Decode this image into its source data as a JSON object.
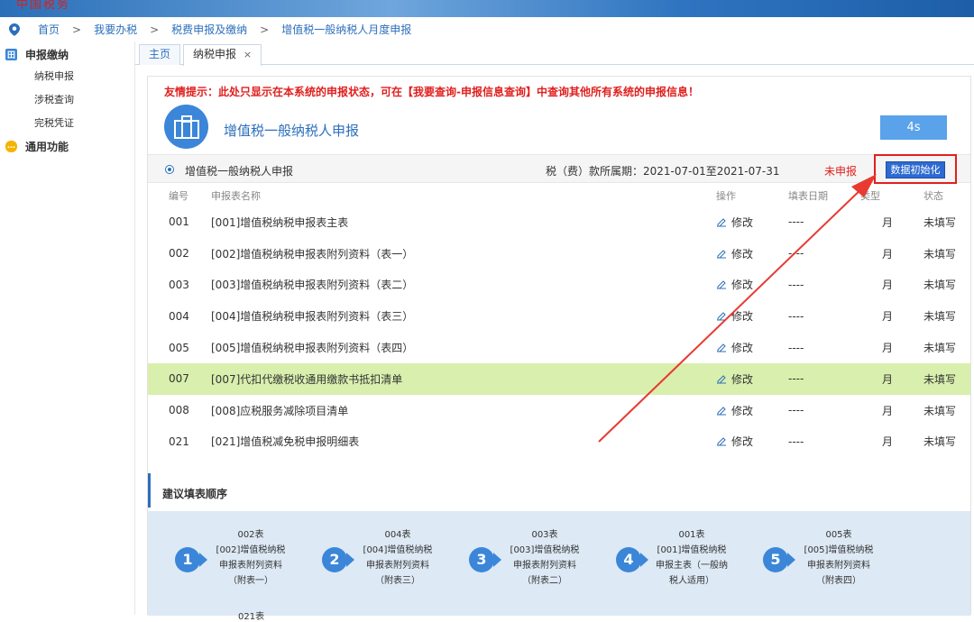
{
  "banner": {
    "logo_text": "中国税务"
  },
  "breadcrumb": {
    "items": [
      "首页",
      "我要办税",
      "税费申报及缴纳",
      "增值税一般纳税人月度申报"
    ],
    "separator": ">"
  },
  "sidebar": {
    "groups": [
      {
        "label": "申报缴纳",
        "icon": "grid-icon",
        "items": [
          "纳税申报",
          "涉税查询",
          "完税凭证"
        ]
      },
      {
        "label": "通用功能",
        "icon": "chat-icon",
        "items": []
      }
    ]
  },
  "tabs": [
    {
      "label": "主页"
    },
    {
      "label": "纳税申报",
      "close": "×"
    }
  ],
  "notice": "友情提示：此处只显示在本系统的申报状态，可在【我要查询-申报信息查询】中查询其他所有系统的申报信息！",
  "header": {
    "title": "增值税一般纳税人申报",
    "timer": "4s"
  },
  "declaration": {
    "name": "增值税一般纳税人申报",
    "period": "税（费）款所属期：2021-07-01至2021-07-31",
    "status": "未申报",
    "init_button": "数据初始化"
  },
  "table": {
    "columns": [
      "编号",
      "申报表名称",
      "操作",
      "填表日期",
      "类型",
      "状态"
    ],
    "rows": [
      {
        "no": "001",
        "name": "[001]增值税纳税申报表主表",
        "op": "修改",
        "date": "----",
        "type": "月",
        "status": "未填写"
      },
      {
        "no": "002",
        "name": "[002]增值税纳税申报表附列资料（表一）",
        "op": "修改",
        "date": "----",
        "type": "月",
        "status": "未填写"
      },
      {
        "no": "003",
        "name": "[003]增值税纳税申报表附列资料（表二）",
        "op": "修改",
        "date": "----",
        "type": "月",
        "status": "未填写"
      },
      {
        "no": "004",
        "name": "[004]增值税纳税申报表附列资料（表三）",
        "op": "修改",
        "date": "----",
        "type": "月",
        "status": "未填写"
      },
      {
        "no": "005",
        "name": "[005]增值税纳税申报表附列资料（表四）",
        "op": "修改",
        "date": "----",
        "type": "月",
        "status": "未填写"
      },
      {
        "no": "007",
        "name": "[007]代扣代缴税收通用缴款书抵扣清单",
        "op": "修改",
        "date": "----",
        "type": "月",
        "status": "未填写"
      },
      {
        "no": "008",
        "name": "[008]应税服务减除项目清单",
        "op": "修改",
        "date": "----",
        "type": "月",
        "status": "未填写"
      },
      {
        "no": "021",
        "name": "[021]增值税减免税申报明细表",
        "op": "修改",
        "date": "----",
        "type": "月",
        "status": "未填写"
      }
    ]
  },
  "suggestion": {
    "title": "建议填表顺序",
    "steps": [
      {
        "num": "1",
        "code": "002表",
        "desc": [
          "[002]增值税纳税",
          "申报表附列资料",
          "（附表一）"
        ]
      },
      {
        "num": "2",
        "code": "004表",
        "desc": [
          "[004]增值税纳税",
          "申报表附列资料",
          "（附表三）"
        ]
      },
      {
        "num": "3",
        "code": "003表",
        "desc": [
          "[003]增值税纳税",
          "申报表附列资料",
          "（附表二）"
        ]
      },
      {
        "num": "4",
        "code": "001表",
        "desc": [
          "[001]增值税纳税",
          "申报主表（一般纳",
          "税人适用）"
        ]
      },
      {
        "num": "5",
        "code": "005表",
        "desc": [
          "[005]增值税纳税",
          "申报表附列资料",
          "（附表四）"
        ]
      }
    ],
    "next_code": "021表"
  },
  "colors": {
    "accent": "#2c6fbb",
    "warn": "#e0201e",
    "pending": "#f08a00",
    "highlight_row": "#d9efad"
  }
}
